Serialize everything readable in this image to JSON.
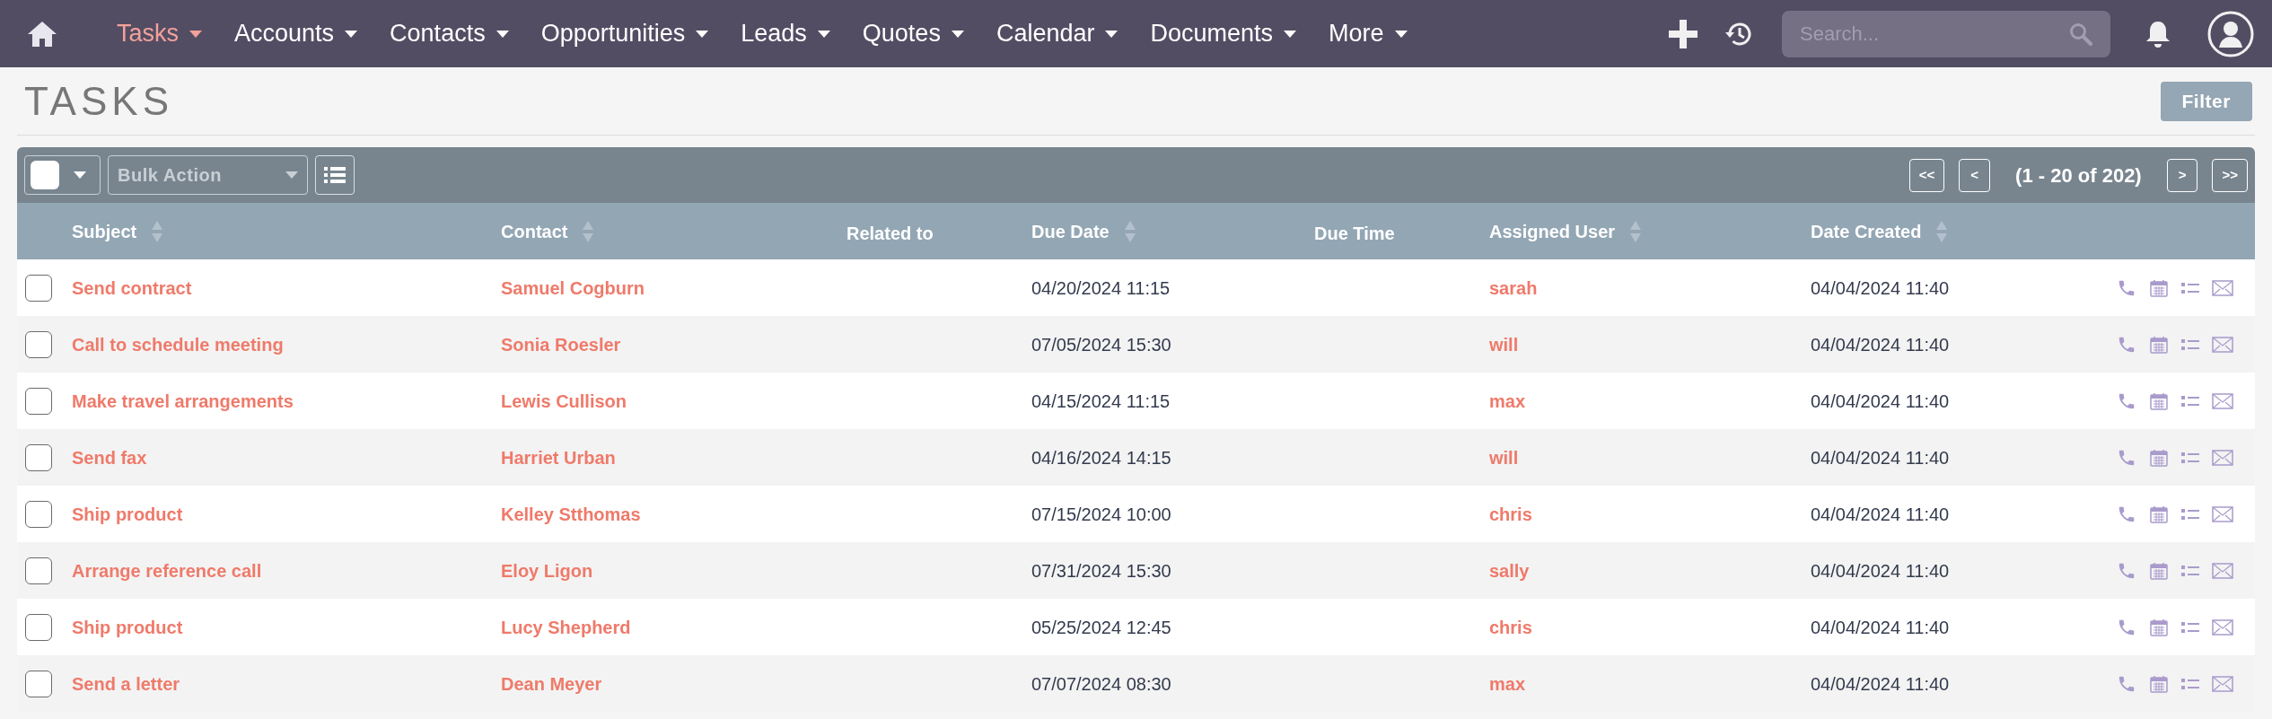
{
  "nav": {
    "tabs": [
      {
        "label": "Tasks",
        "selected": true
      },
      {
        "label": "Accounts",
        "selected": false
      },
      {
        "label": "Contacts",
        "selected": false
      },
      {
        "label": "Opportunities",
        "selected": false
      },
      {
        "label": "Leads",
        "selected": false
      },
      {
        "label": "Quotes",
        "selected": false
      },
      {
        "label": "Calendar",
        "selected": false
      },
      {
        "label": "Documents",
        "selected": false
      },
      {
        "label": "More",
        "selected": false
      }
    ],
    "search": {
      "placeholder": "Search..."
    }
  },
  "page": {
    "title": "TASKS",
    "filter_button": "Filter"
  },
  "toolbar": {
    "select_all": {
      "checked": false
    },
    "bulk_action": "Bulk Action",
    "pagination": {
      "first": "<<",
      "prev": "<",
      "range": "(1 - 20 of 202)",
      "next": ">",
      "last": ">>"
    }
  },
  "table": {
    "columns": [
      {
        "label": "Subject",
        "sortable": true
      },
      {
        "label": "Contact",
        "sortable": true
      },
      {
        "label": "Related to",
        "sortable": false
      },
      {
        "label": "Due Date",
        "sortable": true
      },
      {
        "label": "Due Time",
        "sortable": false
      },
      {
        "label": "Assigned User",
        "sortable": true
      },
      {
        "label": "Date Created",
        "sortable": true
      }
    ],
    "rows": [
      {
        "checked": false,
        "subject": "Send contract",
        "contact": "Samuel Cogburn",
        "due_date": "04/20/2024 11:15",
        "assigned_user": "sarah",
        "date_created": "04/04/2024 11:40"
      },
      {
        "checked": false,
        "subject": "Call to schedule meeting",
        "contact": "Sonia Roesler",
        "due_date": "07/05/2024 15:30",
        "assigned_user": "will",
        "date_created": "04/04/2024 11:40"
      },
      {
        "checked": false,
        "subject": "Make travel arrangements",
        "contact": "Lewis Cullison",
        "due_date": "04/15/2024 11:15",
        "assigned_user": "max",
        "date_created": "04/04/2024 11:40"
      },
      {
        "checked": false,
        "subject": "Send fax",
        "contact": "Harriet Urban",
        "due_date": "04/16/2024 14:15",
        "assigned_user": "will",
        "date_created": "04/04/2024 11:40"
      },
      {
        "checked": false,
        "subject": "Ship product",
        "contact": "Kelley Stthomas",
        "due_date": "07/15/2024 10:00",
        "assigned_user": "chris",
        "date_created": "04/04/2024 11:40"
      },
      {
        "checked": false,
        "subject": "Arrange reference call",
        "contact": "Eloy Ligon",
        "due_date": "07/31/2024 15:30",
        "assigned_user": "sally",
        "date_created": "04/04/2024 11:40"
      },
      {
        "checked": false,
        "subject": "Ship product",
        "contact": "Lucy Shepherd",
        "due_date": "05/25/2024 12:45",
        "assigned_user": "chris",
        "date_created": "04/04/2024 11:40"
      },
      {
        "checked": false,
        "subject": "Send a letter",
        "contact": "Dean Meyer",
        "due_date": "07/07/2024 08:30",
        "assigned_user": "max",
        "date_created": "04/04/2024 11:40"
      }
    ]
  }
}
